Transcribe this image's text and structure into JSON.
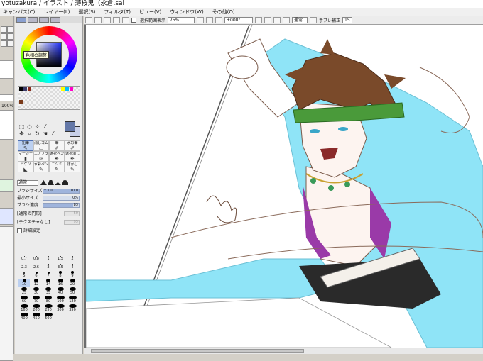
{
  "window": {
    "title": "yotuzakura / イラスト / 薄桜鬼（永倉.sai"
  },
  "menu": [
    {
      "label": "キャンバス(C)"
    },
    {
      "label": "レイヤー(L)"
    },
    {
      "label": "選択(S)"
    },
    {
      "label": "フィルタ(T)"
    },
    {
      "label": "ビュー(V)"
    },
    {
      "label": "ウィンドウ(W)"
    },
    {
      "label": "その他(O)"
    }
  ],
  "left_strip": {
    "zoom_values": [
      "+",
      "+",
      "100%"
    ]
  },
  "color_panel": {
    "tooltip": "色相の調整",
    "fg_color": "#6478a8",
    "bg_color": "#c8d0e8"
  },
  "tools": {
    "brushes": [
      {
        "label": "鉛筆",
        "glyph": "✎",
        "active": true
      },
      {
        "label": "消しゴム",
        "glyph": "▭",
        "active": false
      },
      {
        "label": "筆",
        "glyph": "✐",
        "active": false
      },
      {
        "label": "水彩筆",
        "glyph": "✐",
        "active": false
      },
      {
        "label": "マーカー",
        "glyph": "▮",
        "active": false
      },
      {
        "label": "エアブラシ",
        "glyph": "✑",
        "active": false
      },
      {
        "label": "選択ペン",
        "glyph": "✒",
        "active": false
      },
      {
        "label": "選択消し",
        "glyph": "✒",
        "active": false
      },
      {
        "label": "バケツ",
        "glyph": "◣",
        "active": false
      },
      {
        "label": "水彩ペン",
        "glyph": "✎",
        "active": false
      },
      {
        "label": "ニジミ",
        "glyph": "✎",
        "active": false
      },
      {
        "label": "ぼかし",
        "glyph": "✎",
        "active": false
      }
    ]
  },
  "brush_settings": {
    "blend_mode": "通常",
    "brush_size_label": "ブラシサイズ",
    "brush_size_mult": "x 1.0",
    "brush_size_value": "10.0",
    "min_size_label": "最小サイズ",
    "min_size_value": "0%",
    "density_label": "ブラシ濃度",
    "density_value": "83",
    "shape_label": "[通常の円形]",
    "texture_label": "[テクスチャなし]",
    "shape_strength": "強さ",
    "shape_value": "50",
    "texture_value": "95",
    "detail_label": "詳細設定"
  },
  "sizes": [
    {
      "label": "0.7",
      "d": 1
    },
    {
      "label": "0.8",
      "d": 1
    },
    {
      "label": "1",
      "d": 1
    },
    {
      "label": "1.5",
      "d": 1
    },
    {
      "label": "2",
      "d": 1
    },
    {
      "label": "2.3",
      "d": 1
    },
    {
      "label": "2.6",
      "d": 1
    },
    {
      "label": "3",
      "d": 2
    },
    {
      "label": "3.5",
      "d": 2
    },
    {
      "label": "4",
      "d": 2
    },
    {
      "label": "5",
      "d": 2
    },
    {
      "label": "6",
      "d": 3
    },
    {
      "label": "7",
      "d": 3
    },
    {
      "label": "8",
      "d": 4
    },
    {
      "label": "9",
      "d": 4
    },
    {
      "label": "10",
      "d": 5,
      "active": true
    },
    {
      "label": "12",
      "d": 6
    },
    {
      "label": "14",
      "d": 6
    },
    {
      "label": "16",
      "d": 7
    },
    {
      "label": "20",
      "d": 7
    },
    {
      "label": "25",
      "d": 8
    },
    {
      "label": "30",
      "d": 8
    },
    {
      "label": "35",
      "d": 8
    },
    {
      "label": "40",
      "d": 9
    },
    {
      "label": "50",
      "d": 9
    },
    {
      "label": "60",
      "d": 10
    },
    {
      "label": "70",
      "d": 10
    },
    {
      "label": "80",
      "d": 10
    },
    {
      "label": "100",
      "d": 11
    },
    {
      "label": "120",
      "d": 11
    },
    {
      "label": "160",
      "d": 11
    },
    {
      "label": "200",
      "d": 11
    },
    {
      "label": "250",
      "d": 11
    },
    {
      "label": "300",
      "d": 11
    },
    {
      "label": "350",
      "d": 11
    },
    {
      "label": "400",
      "d": 11
    },
    {
      "label": "450",
      "d": 11
    },
    {
      "label": "500",
      "d": 11
    }
  ],
  "toolbar": {
    "selection_chk_label": "選択範囲表示",
    "zoom": "75%",
    "rotation": "+000°",
    "blend": "通常",
    "stabilizer_label": "手ブレ補正",
    "stabilizer_value": "15"
  }
}
